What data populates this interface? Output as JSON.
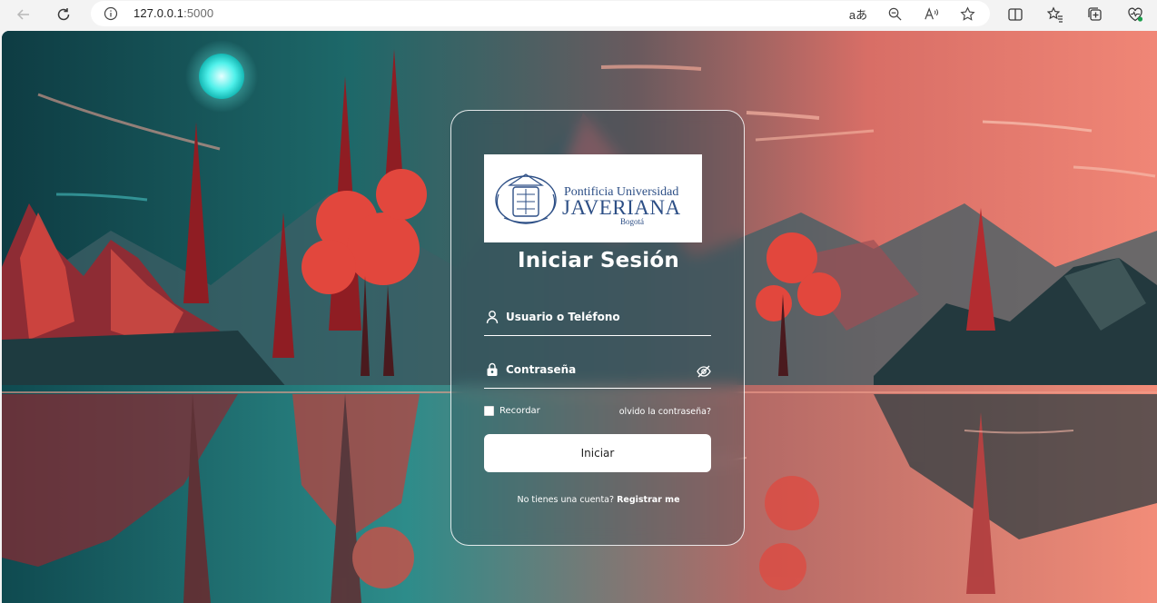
{
  "browser": {
    "url_host": "127.0.0.1",
    "url_port": ":5000",
    "read_aloud_label": "aあ"
  },
  "login": {
    "logo": {
      "line1": "Pontificia Universidad",
      "line2": "JAVERIANA",
      "line3": "Bogotá"
    },
    "title": "Iniciar Sesión",
    "username_placeholder": "Usuario o Teléfono",
    "password_placeholder": "Contraseña",
    "remember_label": "Recordar",
    "forgot_link": "olvido la contraseña?",
    "submit_label": "Iniciar",
    "register_prompt": "No tienes una cuenta?",
    "register_link": "Registrar me"
  },
  "colors": {
    "logo_blue": "#2d4f86",
    "card_border": "#ffffff",
    "sky_left": "#1d6568",
    "sky_right": "#e4766c"
  }
}
